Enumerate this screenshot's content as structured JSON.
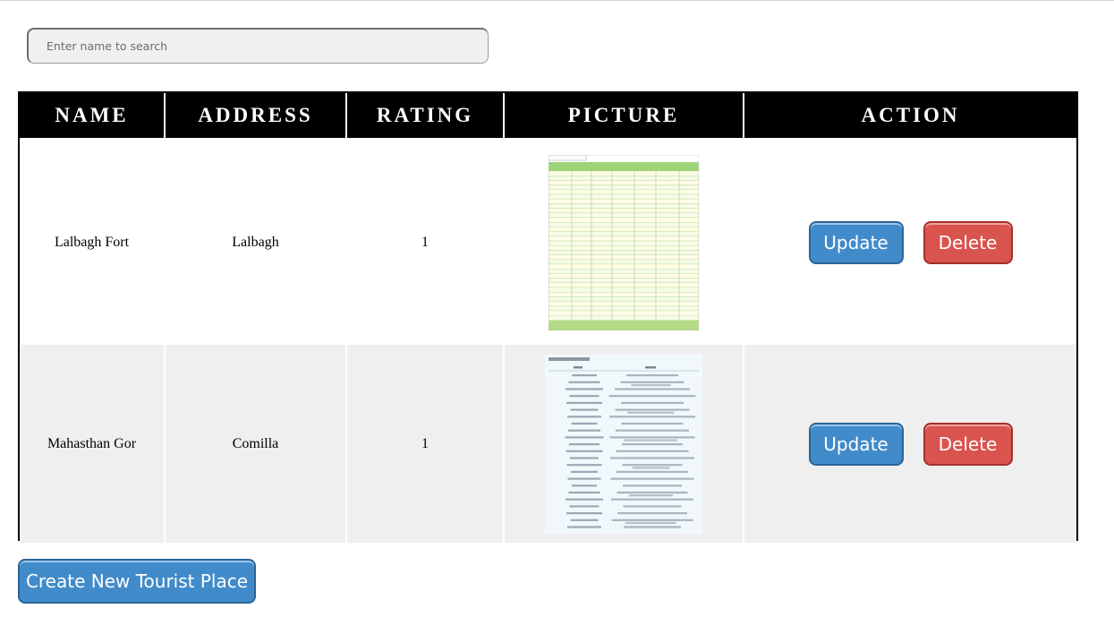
{
  "search": {
    "placeholder": "Enter name to search",
    "value": ""
  },
  "table": {
    "headers": [
      "NAME",
      "ADDRESS",
      "RATING",
      "PICTURE",
      "ACTION"
    ],
    "rows": [
      {
        "name": "Lalbagh Fort",
        "address": "Lalbagh",
        "rating": "1",
        "picture_icon": "spreadsheet-thumbnail",
        "update_label": "Update",
        "delete_label": "Delete"
      },
      {
        "name": "Mahasthan Gor",
        "address": "Comilla",
        "rating": "1",
        "picture_icon": "environment-variables-thumbnail",
        "update_label": "Update",
        "delete_label": "Delete"
      }
    ]
  },
  "create_button": {
    "label": "Create New Tourist Place"
  },
  "colors": {
    "header_bg": "#000000",
    "update": "#428bca",
    "delete": "#d9534f",
    "row_alt": "#efefef"
  }
}
